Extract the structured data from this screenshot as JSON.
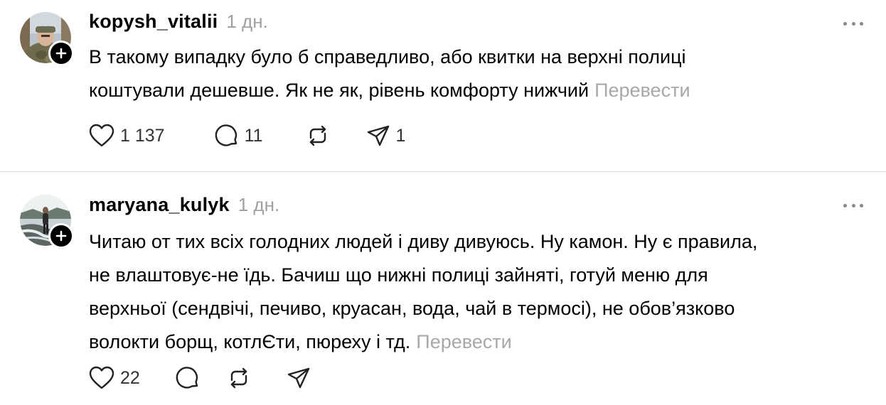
{
  "colors": {
    "text": "#000000",
    "muted": "#a0a0a0",
    "divider": "#d9d9d9",
    "badge": "#000000"
  },
  "posts": [
    {
      "username": "kopysh_vitalii",
      "time": "1 дн.",
      "line1": "В такому випадку було б справедливо, або квитки на верхні полиці",
      "line2": "коштували дешевше. Як не як, рівень комфорту нижчий",
      "translate": "Перевести",
      "likes": "1 137",
      "comments": "11",
      "reposts": "",
      "shares": "1",
      "icons": [
        "heart-icon",
        "comment-icon",
        "repost-icon",
        "share-icon",
        "plus-icon",
        "more-icon"
      ]
    },
    {
      "username": "maryana_kulyk",
      "time": "1 дн.",
      "line1": "Читаю от тих всіх голодних людей і диву дивуюсь. Ну камон. Ну є правила,",
      "line2": "не влаштовує-не їдь. Бачиш що нижні полиці зайняті, готуй меню для",
      "line3": "верхньої (сендвічі, печиво, круасан, вода, чай в термосі), не обов’язково",
      "line4": "волокти борщ, котлЄти, пюреху і тд.",
      "translate": "Перевести",
      "likes": "22",
      "comments": "",
      "reposts": "",
      "shares": "",
      "icons": [
        "heart-icon",
        "comment-icon",
        "repost-icon",
        "share-icon",
        "plus-icon",
        "more-icon"
      ]
    }
  ]
}
